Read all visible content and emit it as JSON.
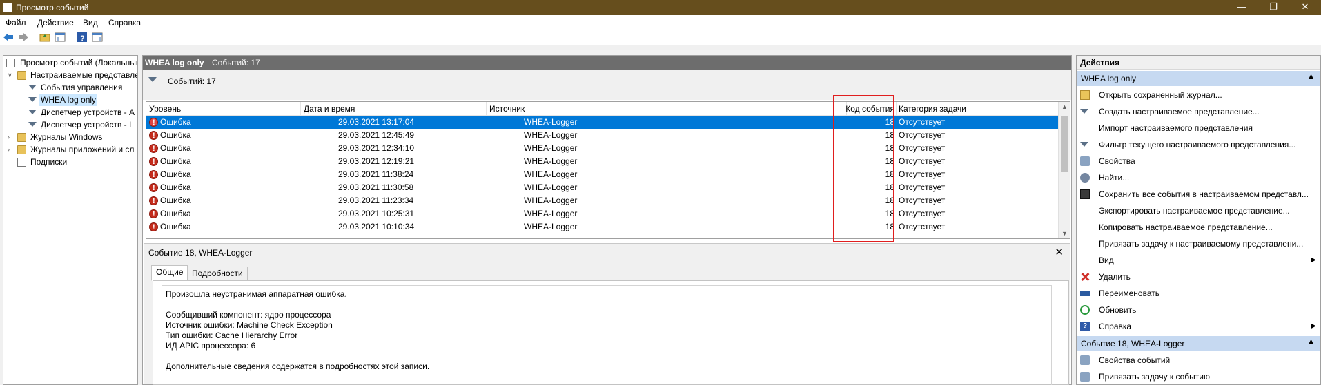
{
  "window": {
    "title": "Просмотр событий"
  },
  "menu": [
    "Файл",
    "Действие",
    "Вид",
    "Справка"
  ],
  "tree": {
    "items": [
      {
        "label": "Просмотр событий (Локальный)",
        "indent": 0
      },
      {
        "label": "Настраиваемые представления",
        "indent": 1
      },
      {
        "label": "События управления",
        "indent": 2
      },
      {
        "label": "WHEA log only",
        "indent": 2,
        "selected": true
      },
      {
        "label": "Диспетчер устройств - А",
        "indent": 2
      },
      {
        "label": "Диспетчер устройств - I",
        "indent": 2
      },
      {
        "label": "Журналы Windows",
        "indent": 1
      },
      {
        "label": "Журналы приложений и сл",
        "indent": 1
      },
      {
        "label": "Подписки",
        "indent": 1
      }
    ]
  },
  "center": {
    "title": "WHEA log only",
    "count_header": "Событий: 17",
    "filter_text": "Событий: 17",
    "columns": [
      "Уровень",
      "Дата и время",
      "Источник",
      "Код события",
      "Категория задачи"
    ],
    "rows": [
      {
        "level": "Ошибка",
        "datetime": "29.03.2021 13:17:04",
        "source": "WHEA-Logger",
        "code": "18",
        "category": "Отсутствует"
      },
      {
        "level": "Ошибка",
        "datetime": "29.03.2021 12:45:49",
        "source": "WHEA-Logger",
        "code": "18",
        "category": "Отсутствует"
      },
      {
        "level": "Ошибка",
        "datetime": "29.03.2021 12:34:10",
        "source": "WHEA-Logger",
        "code": "18",
        "category": "Отсутствует"
      },
      {
        "level": "Ошибка",
        "datetime": "29.03.2021 12:19:21",
        "source": "WHEA-Logger",
        "code": "18",
        "category": "Отсутствует"
      },
      {
        "level": "Ошибка",
        "datetime": "29.03.2021 11:38:24",
        "source": "WHEA-Logger",
        "code": "18",
        "category": "Отсутствует"
      },
      {
        "level": "Ошибка",
        "datetime": "29.03.2021 11:30:58",
        "source": "WHEA-Logger",
        "code": "18",
        "category": "Отсутствует"
      },
      {
        "level": "Ошибка",
        "datetime": "29.03.2021 11:23:34",
        "source": "WHEA-Logger",
        "code": "18",
        "category": "Отсутствует"
      },
      {
        "level": "Ошибка",
        "datetime": "29.03.2021 10:25:31",
        "source": "WHEA-Logger",
        "code": "18",
        "category": "Отсутствует"
      },
      {
        "level": "Ошибка",
        "datetime": "29.03.2021 10:10:34",
        "source": "WHEA-Logger",
        "code": "18",
        "category": "Отсутствует"
      }
    ]
  },
  "detail": {
    "title": "Событие 18, WHEA-Logger",
    "tabs": [
      "Общие",
      "Подробности"
    ],
    "lines": [
      "Произошла неустранимая аппаратная ошибка.",
      "",
      "Сообщивший компонент: ядро процессора",
      "Источник ошибки: Machine Check Exception",
      "Тип ошибки: Cache Hierarchy Error",
      "ИД APIC процессора: 6",
      "",
      "Дополнительные сведения содержатся в подробностях этой записи."
    ]
  },
  "actions": {
    "header": "Действия",
    "section1": "WHEA log only",
    "items1": [
      {
        "label": "Открыть сохраненный журнал...",
        "icon": "open-log-icon"
      },
      {
        "label": "Создать настраиваемое представление...",
        "icon": "create-view-icon"
      },
      {
        "label": "Импорт настраиваемого представления",
        "icon": ""
      },
      {
        "label": "Фильтр текущего настраиваемого представления...",
        "icon": "filter-icon"
      },
      {
        "label": "Свойства",
        "icon": "properties-icon"
      },
      {
        "label": "Найти...",
        "icon": "find-icon"
      },
      {
        "label": "Сохранить все события в настраиваемом представл...",
        "icon": "save-icon"
      },
      {
        "label": "Экспортировать настраиваемое представление...",
        "icon": ""
      },
      {
        "label": "Копировать настраиваемое представление...",
        "icon": ""
      },
      {
        "label": "Привязать задачу к настраиваемому представлени...",
        "icon": ""
      },
      {
        "label": "Вид",
        "icon": "",
        "submenu": true
      },
      {
        "label": "Удалить",
        "icon": "delete-icon"
      },
      {
        "label": "Переименовать",
        "icon": "rename-icon"
      },
      {
        "label": "Обновить",
        "icon": "refresh-icon"
      },
      {
        "label": "Справка",
        "icon": "help-icon",
        "submenu": true
      }
    ],
    "section2": "Событие 18, WHEA-Logger",
    "items2": [
      {
        "label": "Свойства событий",
        "icon": "event-properties-icon"
      },
      {
        "label": "Привязать задачу к событию",
        "icon": "attach-task-icon"
      }
    ]
  }
}
